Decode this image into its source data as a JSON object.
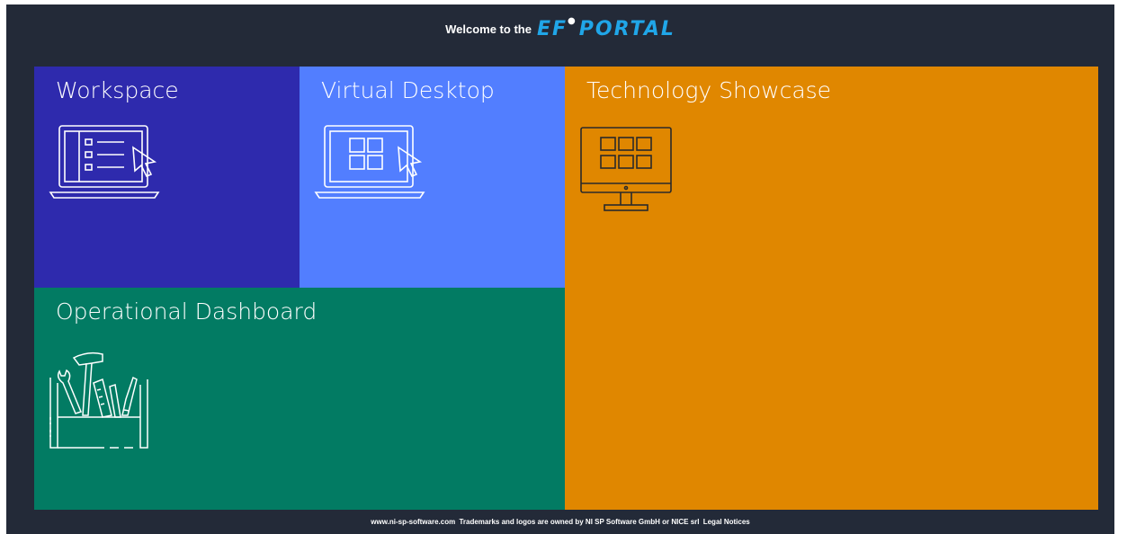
{
  "header": {
    "welcome_text": "Welcome to the",
    "logo_ef": "EF",
    "logo_portal": "PORTAL"
  },
  "tiles": {
    "workspace": {
      "title": "Workspace",
      "icon": "laptop-list-icon",
      "color": "#2e2aad"
    },
    "virtual_desktop": {
      "title": "Virtual Desktop",
      "icon": "laptop-grid-icon",
      "color": "#527eff"
    },
    "technology_showcase": {
      "title": "Technology Showcase",
      "icon": "monitor-grid-icon",
      "color": "#e08700"
    },
    "operational_dashboard": {
      "title": "Operational Dashboard",
      "icon": "toolbox-icon",
      "color": "#027b63"
    }
  },
  "footer": {
    "site": "www.ni-sp-software.com",
    "trademark": "Trademarks and logos are owned by NI SP Software GmbH or NICE srl",
    "legal": "Legal Notices"
  }
}
